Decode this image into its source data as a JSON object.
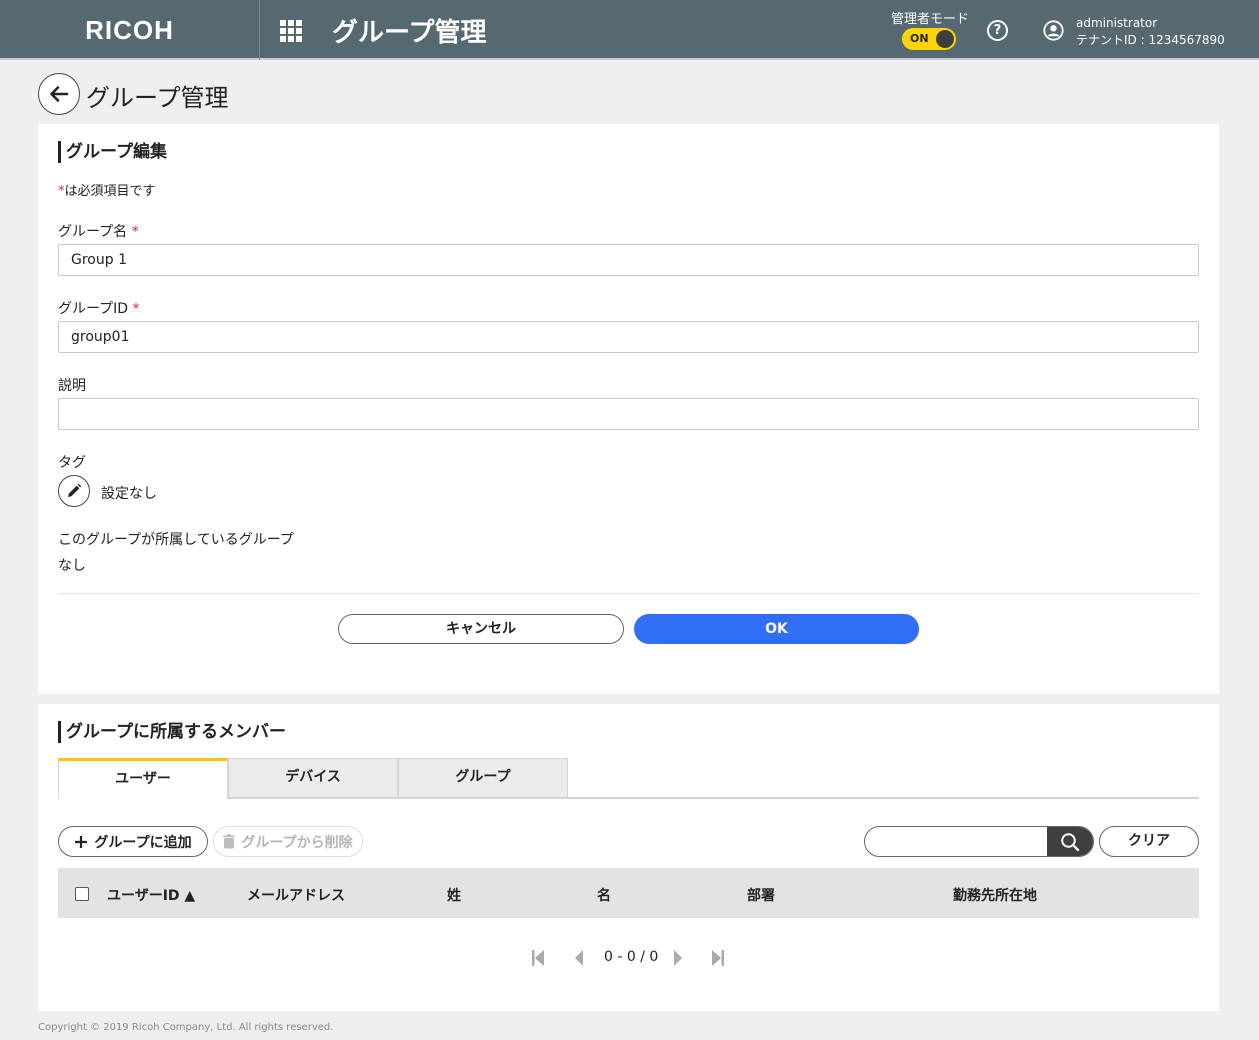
{
  "header": {
    "logo": "RICOH",
    "title": "グループ管理",
    "admin_mode_label": "管理者モード",
    "toggle_label": "ON",
    "user_name": "administrator",
    "tenant": "テナントID : 1234567890"
  },
  "page": {
    "title": "グループ管理"
  },
  "edit_section": {
    "title": "グループ編集",
    "required_star": "*",
    "required_note": "は必須項目です",
    "name_label": "グループ名",
    "name_value": "Group 1",
    "id_label": "グループID",
    "id_value": "group01",
    "desc_label": "説明",
    "desc_value": "",
    "tag_label": "タグ",
    "tag_value": "設定なし",
    "parent_label": "このグループが所属しているグループ",
    "parent_value": "なし",
    "cancel_label": "キャンセル",
    "ok_label": "OK"
  },
  "members_section": {
    "title": "グループに所属するメンバー",
    "tabs": [
      "ユーザー",
      "デバイス",
      "グループ"
    ],
    "add_label": "グループに追加",
    "remove_label": "グループから削除",
    "search_value": "",
    "clear_label": "クリア",
    "columns": [
      "ユーザーID ▲",
      "メールアドレス",
      "姓",
      "名",
      "部署",
      "勤務先所在地"
    ],
    "pagination": "0 - 0 / 0"
  },
  "footer": {
    "copyright": "Copyright © 2019 Ricoh Company, Ltd. All rights reserved."
  },
  "colors": {
    "header_bg": "#566870",
    "toggle_on": "#ffd500",
    "primary": "#2f6ef5",
    "tab_active": "#ffc107",
    "required": "#d32f2f"
  },
  "icons": [
    "apps-grid-icon",
    "help-icon",
    "user-account-icon",
    "back-arrow-icon",
    "pencil-icon",
    "plus-icon",
    "trash-icon",
    "search-icon",
    "first-page-icon",
    "prev-page-icon",
    "next-page-icon",
    "last-page-icon"
  ]
}
